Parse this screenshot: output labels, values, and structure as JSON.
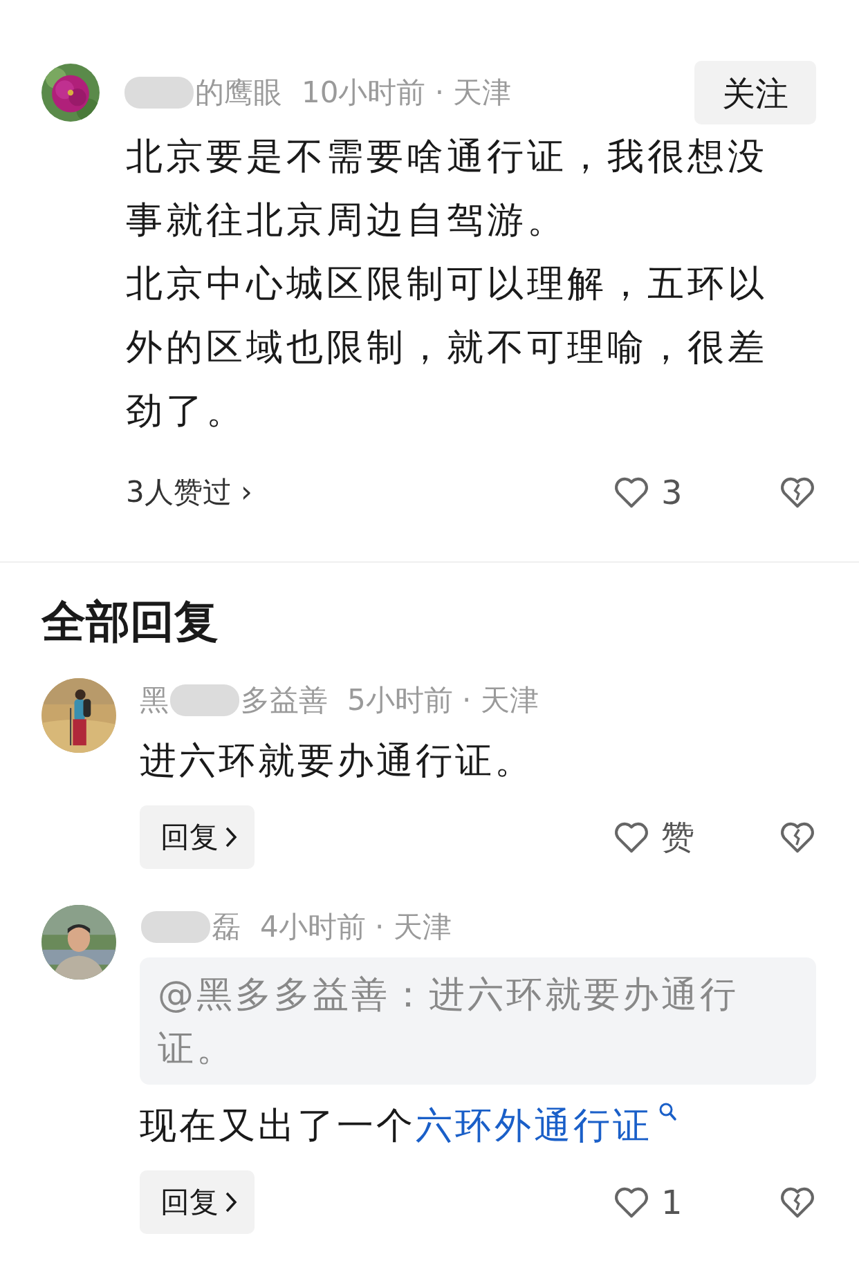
{
  "post": {
    "author": [
      {
        "kind": "redacted"
      },
      {
        "kind": "text",
        "text": "的鹰眼"
      }
    ],
    "meta": "10小时前 · 天津",
    "follow_button": "关注",
    "paragraphs": [
      "北京要是不需要啥通行证，我很想没事就往北京周边自驾游。",
      "北京中心城区限制可以理解，五环以外的区域也限制，就不可理喻，很差劲了。"
    ],
    "likers": "3人赞过",
    "likers_chevron": "›",
    "like_label": "3"
  },
  "section_title": "全部回复",
  "replies": [
    {
      "author": [
        {
          "kind": "text",
          "text": "黑"
        },
        {
          "kind": "redacted"
        },
        {
          "kind": "text",
          "text": "多益善"
        }
      ],
      "meta": "5小时前 · 天津",
      "body": [
        {
          "kind": "text",
          "text": "进六环就要办通行证。"
        }
      ],
      "reply_button": "回复",
      "like_label": "赞"
    },
    {
      "author": [
        {
          "kind": "redacted"
        },
        {
          "kind": "text",
          "text": "磊"
        }
      ],
      "meta": "4小时前 · 天津",
      "quote": "@黑多多益善：进六环就要办通行证。",
      "body": [
        {
          "kind": "text",
          "text": "现在又出了一个"
        },
        {
          "kind": "link",
          "text": "六环外通行证"
        }
      ],
      "reply_button": "回复",
      "like_label": "1"
    }
  ]
}
